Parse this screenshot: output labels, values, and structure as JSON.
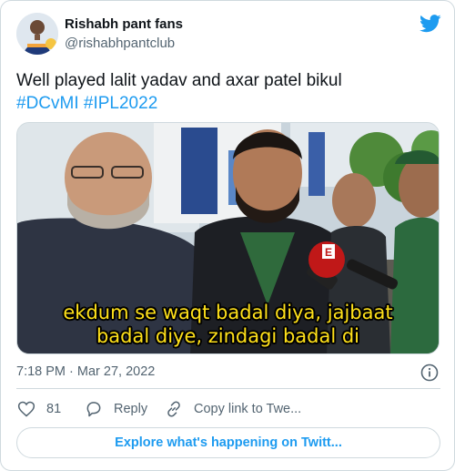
{
  "author": {
    "name": "Rishabh pant fans",
    "handle": "@rishabhpantclub"
  },
  "tweet": {
    "text": "Well played lalit yadav and axar patel bikul",
    "hashtags": [
      "#DCvMI",
      "#IPL2022"
    ]
  },
  "media": {
    "caption_line1": "ekdum se waqt badal diya, jajbaat",
    "caption_line2": "badal diye, zindagi badal di",
    "mic_flag_text": "E"
  },
  "meta": {
    "timestamp": "7:18 PM · Mar 27, 2022"
  },
  "actions": {
    "like_count": "81",
    "reply_label": "Reply",
    "copy_label": "Copy link to Twe..."
  },
  "explore_label": "Explore what's happening on Twitt...",
  "colors": {
    "accent": "#1d9bf0",
    "muted": "#536471",
    "border": "#cfd9de",
    "caption": "#ffe11a"
  },
  "icons": [
    "twitter-bird-icon",
    "info-icon",
    "heart-icon",
    "reply-icon",
    "link-icon"
  ]
}
